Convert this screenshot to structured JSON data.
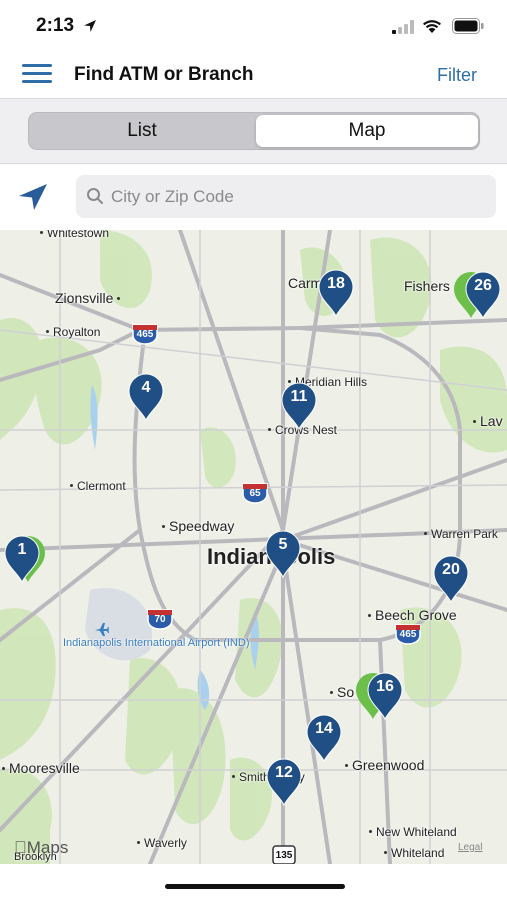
{
  "status": {
    "time": "2:13"
  },
  "header": {
    "title": "Find ATM or Branch",
    "filter_label": "Filter"
  },
  "segments": {
    "list_label": "List",
    "map_label": "Map",
    "selected": "Map"
  },
  "search": {
    "placeholder": "City or Zip Code",
    "value": ""
  },
  "map": {
    "labels": {
      "whitestown": "Whitestown",
      "zionsville": "Zionsville",
      "royalton": "Royalton",
      "carmel": "Carmel",
      "fishers": "Fishers",
      "meridian_hills": "Meridian Hills",
      "crows_nest": "Crows Nest",
      "lawrence": "Lav",
      "clermont": "Clermont",
      "speedway": "Speedway",
      "indianapolis": "Indianapolis",
      "warren_park": "Warren Park",
      "beech_grove": "Beech Grove",
      "airport": "Indianapolis International Airport (IND)",
      "southport": "So",
      "mooresville": "Mooresville",
      "greenwood": "Greenwood",
      "smith_valley": "Smith Valley",
      "waverly": "Waverly",
      "new_whiteland": "New Whiteland",
      "whiteland": "Whiteland",
      "brooklyn": "Brooklyn",
      "maps": "Maps",
      "legal": "Legal"
    },
    "shields": [
      "465",
      "465",
      "65",
      "70",
      "465",
      "135"
    ],
    "pins": [
      {
        "id": "1",
        "label": "1",
        "has_green": true
      },
      {
        "id": "4",
        "label": "4",
        "has_green": false
      },
      {
        "id": "5",
        "label": "5",
        "has_green": false
      },
      {
        "id": "11",
        "label": "11",
        "has_green": false
      },
      {
        "id": "12",
        "label": "12",
        "has_green": false
      },
      {
        "id": "14",
        "label": "14",
        "has_green": false
      },
      {
        "id": "16",
        "label": "16",
        "has_green": true
      },
      {
        "id": "18",
        "label": "18",
        "has_green": false
      },
      {
        "id": "20",
        "label": "20",
        "has_green": false
      },
      {
        "id": "26",
        "label": "26",
        "has_green": true
      }
    ],
    "colors": {
      "pin": "#1f4f85",
      "pin_green": "#6cc04a",
      "accent": "#2f6fa8",
      "highway_shield": "#2a5caa"
    }
  }
}
